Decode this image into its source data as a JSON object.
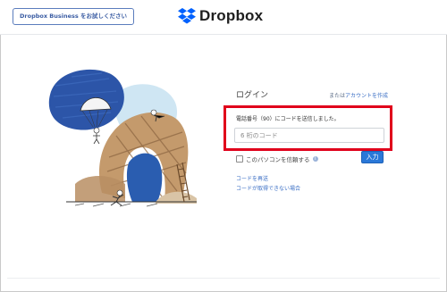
{
  "header": {
    "trial_button_label": "Dropbox Business をお試しください",
    "brand_name": "Dropbox"
  },
  "login": {
    "title": "ログイン",
    "or_prefix": "または",
    "create_account_link": "アカウントを作成",
    "sent_message": "電話番号（90）にコードを送信しました。",
    "code_placeholder": "6 桁のコード",
    "code_value": "",
    "trust_label": "このパソコンを信頼する",
    "info_icon": "info-icon",
    "submit_label": "入力",
    "resend_link": "コードを再送",
    "cannot_receive_link": "コードが取得できない場合"
  },
  "colors": {
    "brand_blue": "#0061fe",
    "button_blue": "#2a78d8",
    "link_blue": "#3b6fc5",
    "highlight_red": "#e0001b"
  }
}
